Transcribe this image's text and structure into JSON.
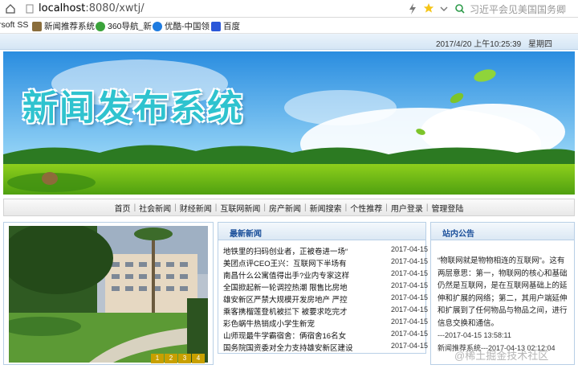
{
  "browser": {
    "address_host": "localhost",
    "address_path": ":8080/xwtj/",
    "search_placeholder": "习近平会见美国国务卿",
    "bookmarks": [
      {
        "label": "rsoft SS",
        "icon": "none"
      },
      {
        "label": "新闻推荐系统",
        "icon": "page-icon"
      },
      {
        "label": "360导航_新",
        "icon": "360-icon"
      },
      {
        "label": "优酷-中国领",
        "icon": "youku-icon"
      },
      {
        "label": "百度",
        "icon": "baidu-icon"
      }
    ]
  },
  "header": {
    "datetime": "2017/4/20 上午10:25:39",
    "weekday": "星期四",
    "banner_title": "新闻发布系统"
  },
  "nav": {
    "items": [
      "首页",
      "社会新闻",
      "财经新闻",
      "互联网新闻",
      "房产新闻",
      "新闻搜索",
      "个性推荐",
      "用户登录",
      "管理登陆"
    ]
  },
  "photo": {
    "pager": [
      "1",
      "2",
      "3",
      "4"
    ]
  },
  "news": {
    "title": "最新新闻",
    "items": [
      {
        "title": "地铁里的扫码创业者，正被卷进一场“",
        "date": "2017-04-15"
      },
      {
        "title": "美团点评CEO王兴：互联网下半场有",
        "date": "2017-04-15"
      },
      {
        "title": "南昌什么公寓值得出手?业内专家这样",
        "date": "2017-04-15"
      },
      {
        "title": "全国掀起新一轮调控热潮 限售比房地",
        "date": "2017-04-15"
      },
      {
        "title": "雄安新区严禁大规模开发房地产 严控",
        "date": "2017-04-15"
      },
      {
        "title": "乘客携榴莲登机被拦下 被要求吃完才",
        "date": "2017-04-15"
      },
      {
        "title": "彩色蜗牛热销成小学生新宠",
        "date": "2017-04-15"
      },
      {
        "title": "山师现最牛学霸宿舍：俩宿舍16名女",
        "date": "2017-04-15"
      },
      {
        "title": "国务院国资委对全力支持雄安新区建设",
        "date": "2017-04-15"
      }
    ]
  },
  "notice": {
    "title": "站内公告",
    "body": "“物联网就是物物相连的互联网”。这有两层意思：第一，物联网的核心和基础仍然是互联网，是在互联网基础上的延伸和扩展的网络；第二，其用户端延伸和扩展到了任何物品与物品之间，进行信息交换和通信。",
    "trailer": "---2017-04-15 13:58:11",
    "line2": "新闻推荐系统---2017-04-13 02:12:04"
  },
  "watermark": "@稀土掘金技术社区"
}
